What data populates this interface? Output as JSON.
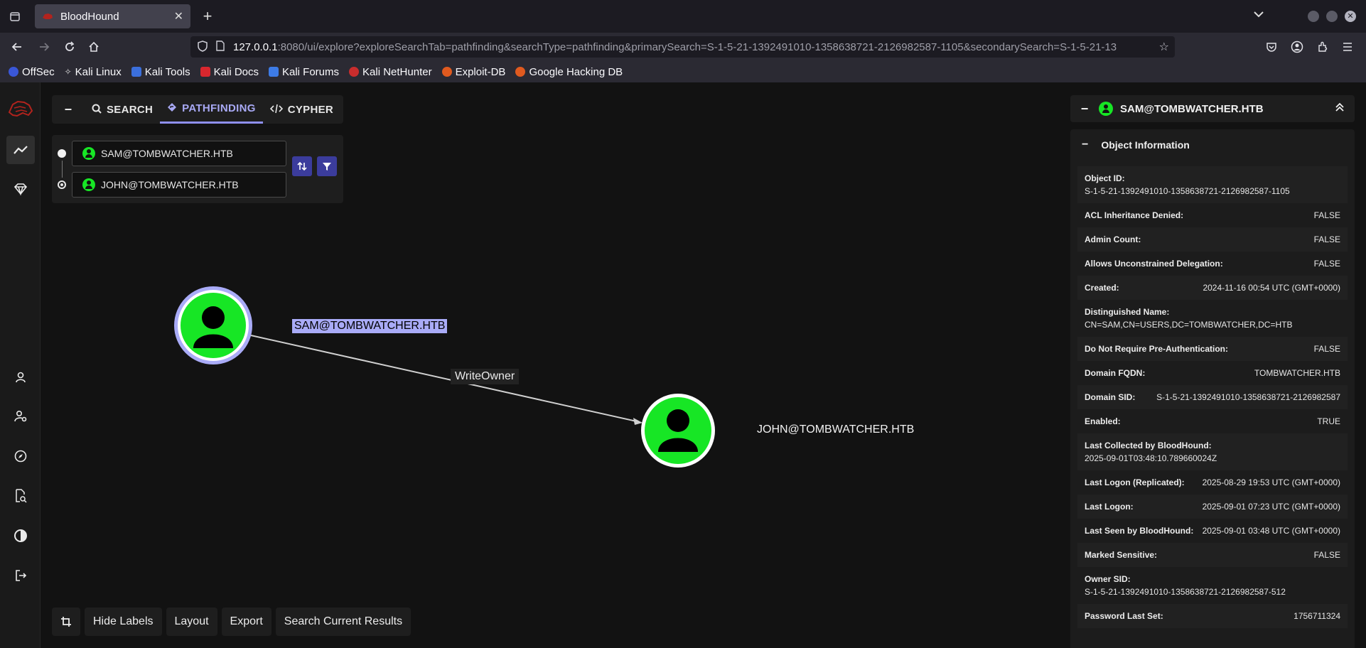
{
  "browser": {
    "tab_title": "BloodHound",
    "url_host": "127.0.0.1",
    "url_rest": ":8080/ui/explore?exploreSearchTab=pathfinding&searchType=pathfinding&primarySearch=S-1-5-21-1392491010-1358638721-2126982587-1105&secondarySearch=S-1-5-21-13",
    "bookmarks": [
      "OffSec",
      "Kali Linux",
      "Kali Tools",
      "Kali Docs",
      "Kali Forums",
      "Kali NetHunter",
      "Exploit-DB",
      "Google Hacking DB"
    ]
  },
  "search_tabs": {
    "search": "SEARCH",
    "pathfinding": "PATHFINDING",
    "cypher": "CYPHER"
  },
  "pathfinding": {
    "start": "SAM@TOMBWATCHER.HTB",
    "end": "JOHN@TOMBWATCHER.HTB"
  },
  "graph": {
    "source_label": "SAM@TOMBWATCHER.HTB",
    "target_label": "JOHN@TOMBWATCHER.HTB",
    "edge_label": "WriteOwner",
    "node_color": "#17e625",
    "selected_ring_color": "#a9abf7"
  },
  "bottom_bar": {
    "hide_labels": "Hide Labels",
    "layout": "Layout",
    "export": "Export",
    "search_results": "Search Current Results"
  },
  "panel": {
    "title": "SAM@TOMBWATCHER.HTB",
    "section": "Object Information",
    "props": [
      {
        "k": "Object ID:",
        "v": "S-1-5-21-1392491010-1358638721-2126982587-1105",
        "tall": true
      },
      {
        "k": "ACL Inheritance Denied:",
        "v": "FALSE"
      },
      {
        "k": "Admin Count:",
        "v": "FALSE"
      },
      {
        "k": "Allows Unconstrained Delegation:",
        "v": "FALSE"
      },
      {
        "k": "Created:",
        "v": "2024-11-16 00:54 UTC (GMT+0000)"
      },
      {
        "k": "Distinguished Name:",
        "v": "CN=SAM,CN=USERS,DC=TOMBWATCHER,DC=HTB",
        "tall": true
      },
      {
        "k": "Do Not Require Pre-Authentication:",
        "v": "FALSE"
      },
      {
        "k": "Domain FQDN:",
        "v": "TOMBWATCHER.HTB"
      },
      {
        "k": "Domain SID:",
        "v": "S-1-5-21-1392491010-1358638721-2126982587"
      },
      {
        "k": "Enabled:",
        "v": "TRUE"
      },
      {
        "k": "Last Collected by BloodHound:",
        "v": "2025-09-01T03:48:10.789660024Z",
        "tall": true
      },
      {
        "k": "Last Logon (Replicated):",
        "v": "2025-08-29 19:53 UTC (GMT+0000)"
      },
      {
        "k": "Last Logon:",
        "v": "2025-09-01 07:23 UTC (GMT+0000)"
      },
      {
        "k": "Last Seen by BloodHound:",
        "v": "2025-09-01 03:48 UTC (GMT+0000)"
      },
      {
        "k": "Marked Sensitive:",
        "v": "FALSE"
      },
      {
        "k": "Owner SID:",
        "v": "S-1-5-21-1392491010-1358638721-2126982587-512",
        "tall": true
      },
      {
        "k": "Password Last Set:",
        "v": "1756711324"
      }
    ]
  }
}
